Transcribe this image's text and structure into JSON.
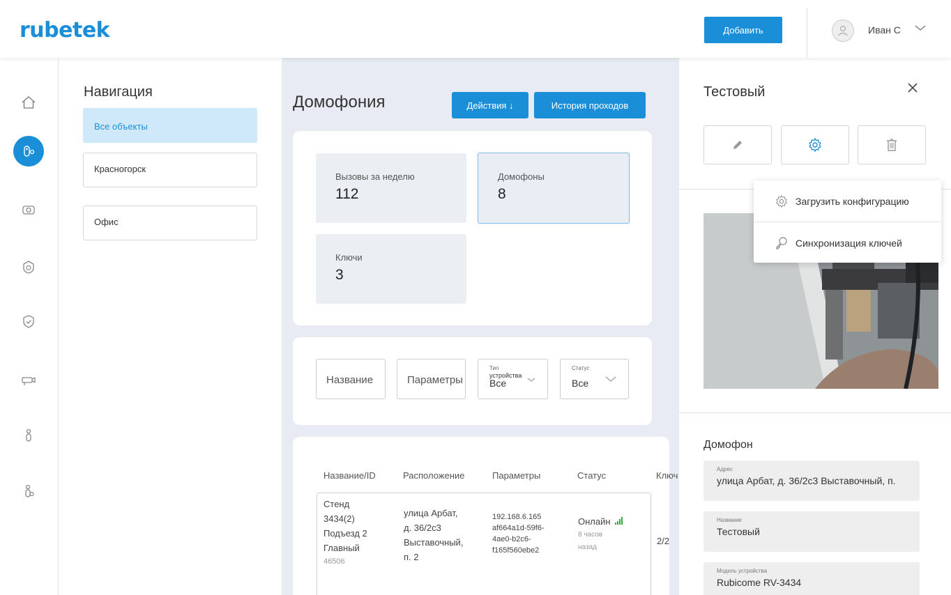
{
  "header": {
    "logo": "rubetek",
    "add_label": "Добавить",
    "user_name": "Иван С"
  },
  "rail": [
    "home-icon",
    "intercom-icon",
    "camera-icon",
    "fire-alarm-icon",
    "security-shield-icon",
    "cctv-camera-icon",
    "person-icon",
    "person-badge-icon"
  ],
  "navigation": {
    "title": "Навигация",
    "items": [
      {
        "label": "Все объекты"
      },
      {
        "label": "Красногорск"
      },
      {
        "label": "Офис"
      }
    ]
  },
  "main": {
    "title": "Домофония",
    "actions_label": "Действия ↓",
    "history_label": "История проходов",
    "stats": [
      {
        "label": "Вызовы за неделю",
        "value": "112"
      },
      {
        "label": "Домофоны",
        "value": "8"
      },
      {
        "label": "Ключи",
        "value": "3"
      }
    ],
    "filters": {
      "name": "Название",
      "params": "Параметры",
      "type_label": "Тип",
      "type_sub": "устройства",
      "type_value": "Все",
      "status_label": "Статус",
      "status_value": "Все"
    },
    "table": {
      "headers": [
        "Название/ID",
        "Расположение",
        "Параметры",
        "Статус",
        "Ключ"
      ],
      "row": {
        "name": [
          "Стенд",
          "3434(2)",
          "Подъезд 2",
          "Главный"
        ],
        "id": "46506",
        "location": [
          "улица Арбат,",
          "д. 36/2с3",
          "Выставочный,",
          "п. 2"
        ],
        "params": [
          "192.168.6.165",
          "af664a1d-59f6-",
          "4ae0-b2c6-",
          "f165f560ebe2"
        ],
        "status": "Онлайн",
        "status_time": [
          "8 часов",
          "назад"
        ],
        "keys": "2/2"
      }
    }
  },
  "detail": {
    "title": "Тестовый",
    "section_title": "Домофон",
    "fields": [
      {
        "label": "Адрес",
        "value": "улица Арбат, д. 36/2с3 Выставочный, п."
      },
      {
        "label": "Название",
        "value": "Тестовый"
      },
      {
        "label": "Модель устройства",
        "value": "Rubicome RV-3434"
      }
    ]
  },
  "dropdown": {
    "items": [
      {
        "label": "Загрузить конфигурацию"
      },
      {
        "label": "Синхронизация ключей"
      }
    ]
  },
  "colors": {
    "accent": "#1a8fd8",
    "selected_bg": "#cfe9fb",
    "main_bg": "#e8ebf3",
    "signal": "#3aa83a"
  }
}
